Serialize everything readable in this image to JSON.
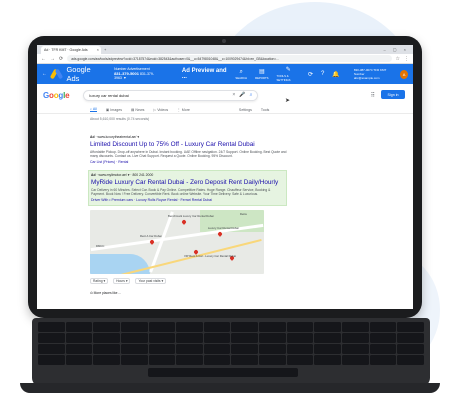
{
  "browser": {
    "tab_title": "Ad · TFR KMT · Google Ads",
    "tab_close": "×",
    "new_tab": "+",
    "window_controls": "– ▢ ×",
    "url": "ads.google.com/aw/tools/adpreview?ocid=37187574&euid=382543&authuser=0&__u=5479801048&__c=1009029474&hl=en_GB&location=..."
  },
  "ads_header": {
    "product": "Google Ads",
    "account_label": "Number Advertisement",
    "account_id": "831-379-5001",
    "account_id2": "831-379-3963",
    "page_title": "Ad Preview and ...",
    "tools": [
      {
        "icon": "⌕",
        "label": "SEARCH"
      },
      {
        "icon": "▤",
        "label": "REPORTS"
      },
      {
        "icon": "✎",
        "label": "TOOLS & SETTINGS"
      }
    ],
    "user_line1": "830-387-0074 TFR KMT Number",
    "user_line2": "abc@example.com",
    "avatar_letter": "A"
  },
  "google": {
    "logo": "Google",
    "logo_colors": [
      "#4285F4",
      "#EA4335",
      "#FBBC05",
      "#4285F4",
      "#34A853",
      "#EA4335"
    ],
    "query": "luxury car rental dubai",
    "clear_icon": "×",
    "mic_icon": "🎤",
    "search_icon": "⌕",
    "apps_icon": "⠿",
    "sign_in": "Sign in",
    "tabs": [
      "All",
      "Images",
      "News",
      "Videos",
      "More"
    ],
    "settings": "Settings",
    "tools": "Tools",
    "stats": "About 5,610,000 results (0.74 seconds)"
  },
  "ad1": {
    "badge": "Ad",
    "url": "· www.luxurytheatrental.ae/ ▾",
    "title": "Limited Discount Up to 75% Off - Luxury Car Rental Dubai",
    "desc": "Affordable Pickup. Drop-off anywhere in Dubai. Instant booking. UAE Offline navigation. 24/7 Support. Online Booking. Best Quote and many discounts. Contact us. Live Chat Support. Request a Quote. Online Booking. 95% Discount.",
    "link": "Car List (Prices) · Rental"
  },
  "ad2": {
    "badge": "Ad",
    "url": "· www.mylimotor.ae/ ▾ · 800 241 2000",
    "title": "MyRide Luxury Car Rental Dubai - Zero Deposit Rent Daily/Hourly",
    "desc": "Car Delivery in 60 Minutes. Select Car. Book & Pay Online. Competitive Rates. Huge Range. Chauffeur Service, Booking & Payment. Book Now ! Free Delivery. Convertible Rent. Book online Website. Your Time Delivery. Safe & Luxurious.",
    "link": "Driver With • Premium cars · Luxury Rolls Royce Rental · Ferrari Rental Dubai"
  },
  "map_labels": [
    "Benchmark Luxury Car Rental Dubai",
    "Luxury Car Rental Dubai",
    "Deira",
    "DMCC",
    "Rent A Car Dubai",
    "VIP Rent A Car - Luxury Car Rental Dubai"
  ],
  "filters": [
    "Rating ▾",
    "Hours ▾",
    "Your past visits ▾"
  ],
  "more_results": "⊙ More places like ..."
}
